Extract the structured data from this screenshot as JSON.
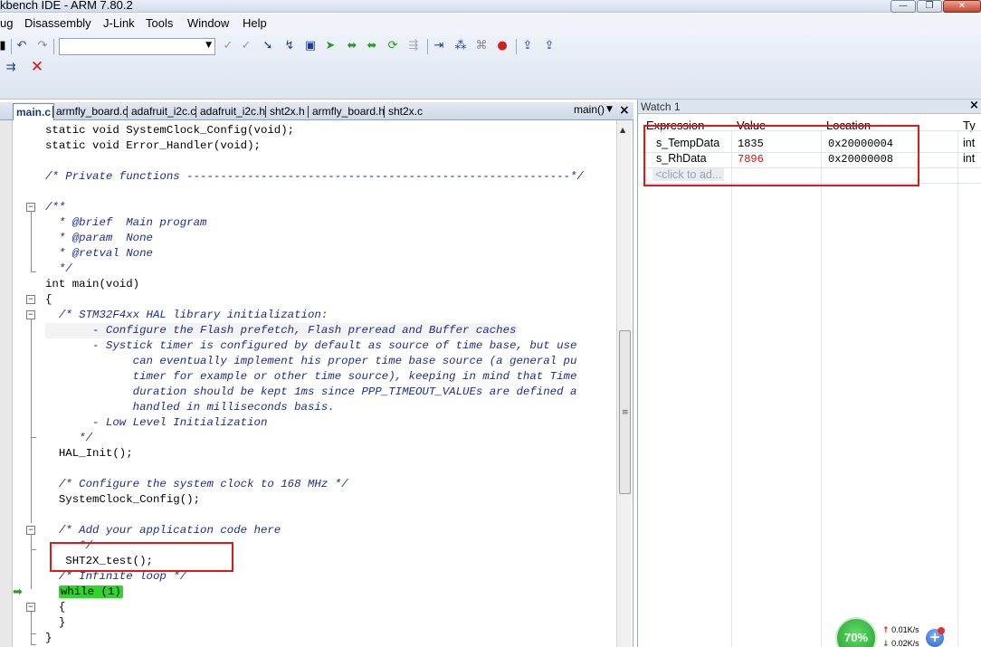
{
  "window": {
    "title": "kbench IDE - ARM 7.80.2",
    "buttons": {
      "minimize": "—",
      "restore": "❐",
      "close": "✕"
    }
  },
  "menu": [
    "ug",
    "Disassembly",
    "J-Link",
    "Tools",
    "Window",
    "Help"
  ],
  "toolbar": {
    "undo_icon": "undo-icon",
    "redo_icon": "redo-icon",
    "combo_value": "",
    "stop_label": "✕"
  },
  "editor": {
    "tabs": [
      "main.c",
      "armfly_board.c",
      "adafruit_i2c.c",
      "adafruit_i2c.h",
      "sht2x.h",
      "armfly_board.h",
      "sht2x.c"
    ],
    "active_tab": "main.c",
    "function_selector": "main()",
    "lines": [
      {
        "text": "static void SystemClock_Config(void);",
        "type": "code"
      },
      {
        "text": "static void Error_Handler(void);",
        "type": "code"
      },
      {
        "text": "",
        "type": "code"
      },
      {
        "text": "/* Private functions ---------------------------------------------------------*/",
        "type": "comment"
      },
      {
        "text": "",
        "type": "code"
      },
      {
        "text": "/**",
        "type": "comment"
      },
      {
        "text": "  * @brief  Main program",
        "type": "comment"
      },
      {
        "text": "  * @param  None",
        "type": "comment"
      },
      {
        "text": "  * @retval None",
        "type": "comment"
      },
      {
        "text": "  */",
        "type": "comment"
      },
      {
        "text": "int main(void)",
        "type": "code"
      },
      {
        "text": "{",
        "type": "code"
      },
      {
        "text": "  /* STM32F4xx HAL library initialization:",
        "type": "comment"
      },
      {
        "text": "       - Configure the Flash prefetch, Flash preread and Buffer caches",
        "type": "comment",
        "highlight": true
      },
      {
        "text": "       - Systick timer is configured by default as source of time base, but use",
        "type": "comment"
      },
      {
        "text": "             can eventually implement his proper time base source (a general pu",
        "type": "comment"
      },
      {
        "text": "             timer for example or other time source), keeping in mind that Time",
        "type": "comment"
      },
      {
        "text": "             duration should be kept 1ms since PPP_TIMEOUT_VALUEs are defined a",
        "type": "comment"
      },
      {
        "text": "             handled in milliseconds basis.",
        "type": "comment"
      },
      {
        "text": "       - Low Level Initialization",
        "type": "comment"
      },
      {
        "text": "     */",
        "type": "comment"
      },
      {
        "text": "  HAL_Init();",
        "type": "code"
      },
      {
        "text": "",
        "type": "code"
      },
      {
        "text": "  /* Configure the system clock to 168 MHz */",
        "type": "comment"
      },
      {
        "text": "  SystemClock_Config();",
        "type": "code"
      },
      {
        "text": "",
        "type": "code"
      },
      {
        "text": "  /* Add your application code here",
        "type": "comment"
      },
      {
        "text": "     */",
        "type": "comment"
      },
      {
        "text": "   SHT2X_test();",
        "type": "code"
      },
      {
        "text": "  /* Infinite loop */",
        "type": "comment"
      },
      {
        "text": "  while (1)",
        "type": "current"
      },
      {
        "text": "  {",
        "type": "code"
      },
      {
        "text": "  }",
        "type": "code"
      },
      {
        "text": "}",
        "type": "code"
      }
    ]
  },
  "watch": {
    "title": "Watch 1",
    "close": "×",
    "columns": [
      "Expression",
      "Value",
      "Location",
      "Ty"
    ],
    "rows": [
      {
        "expression": "s_TempData",
        "value": "1835",
        "location": "0x20000004",
        "type": "int",
        "value_color": "#000000"
      },
      {
        "expression": "s_RhData",
        "value": "7896",
        "location": "0x20000008",
        "type": "int",
        "value_color": "#cc1111"
      }
    ],
    "placeholder": "<click to ad..."
  },
  "network": {
    "percent": "70%",
    "up": "0.01K/s",
    "down": "0.02K/s"
  },
  "colors": {
    "accent_red": "#e01818",
    "current_line": "#2bd72b",
    "comment": "#1b2e8a"
  }
}
